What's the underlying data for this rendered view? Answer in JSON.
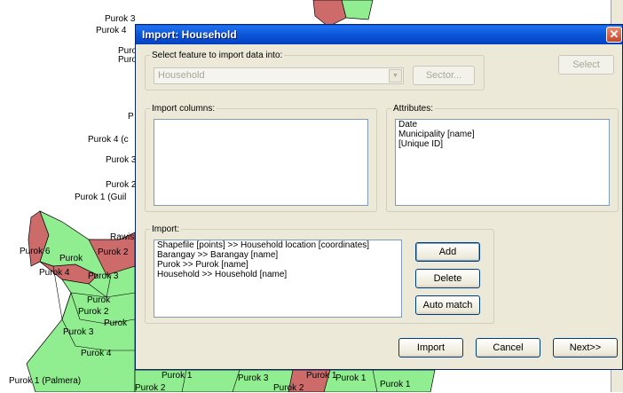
{
  "dialog": {
    "title": "Import: Household",
    "close_glyph": "✕",
    "feature_group_label": "Select feature to import data into:",
    "feature_select_value": "Household",
    "sector_button": "Sector...",
    "select_button": "Select",
    "import_columns_label": "Import columns:",
    "import_columns_items": [],
    "attributes_label": "Attributes:",
    "attributes_items": [
      "Date",
      "Municipality [name]",
      "[Unique ID]"
    ],
    "import_group_label": "Import:",
    "import_items": [
      "Shapefile [points] >> Household location [coordinates]",
      "Barangay >> Barangay [name]",
      "Purok >> Purok [name]",
      "Household >> Household [name]"
    ],
    "add_button": "Add",
    "delete_button": "Delete",
    "auto_match_button": "Auto match",
    "import_button": "Import",
    "cancel_button": "Cancel",
    "next_button": "Next>>"
  },
  "map": {
    "labels": [
      "Purok 3",
      "Purok 4",
      "Puro",
      "Puro",
      "P",
      "Purok 4 (c",
      "Purok 3",
      "Purok 2",
      "Purok 1 (Guil",
      "Rawis",
      "Purok 6",
      "Purok",
      "Purok 2",
      "Purok 4",
      "Purok 3",
      "Purok",
      "Purok 2",
      "Purok",
      "Purok 3",
      "Purok 4",
      "Purok 1 (Palmera)",
      "Purok 1",
      "Purok 2",
      "Purok 3",
      "Purok 2",
      "Purok 1",
      "Purok 1",
      "Purok 1"
    ],
    "colors": {
      "green": "#90ee90",
      "red": "#cd6b6b",
      "outline": "#000000"
    }
  }
}
